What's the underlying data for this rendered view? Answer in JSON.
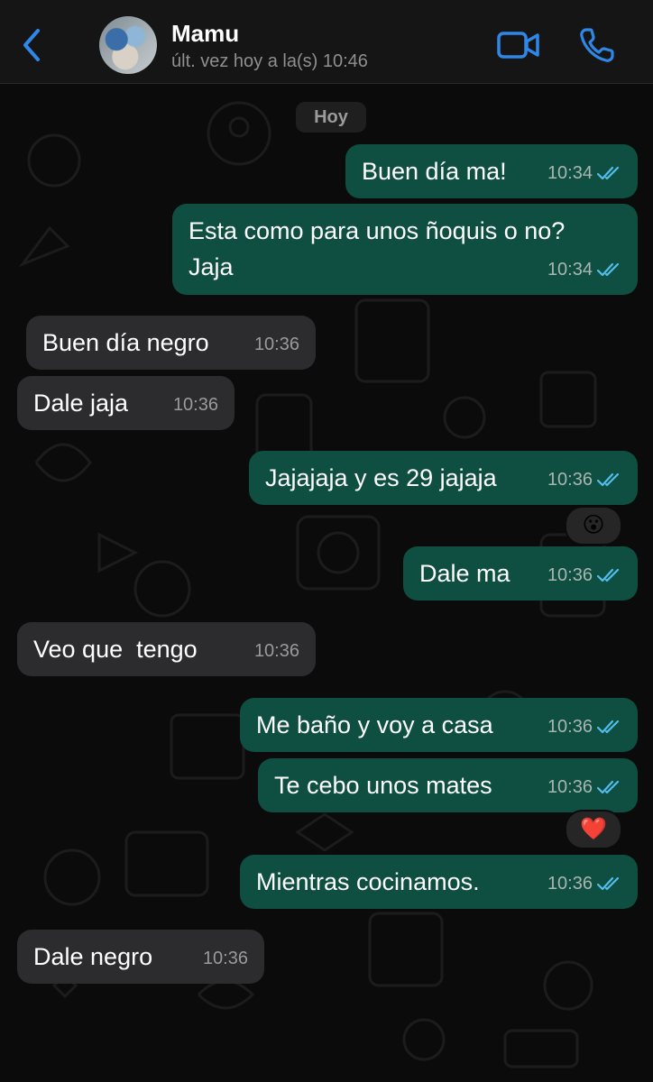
{
  "header": {
    "contact_name": "Mamu",
    "last_seen": "últ. vez hoy a la(s) 10:46",
    "back_icon": "chevron-left-icon",
    "video_icon": "video-camera-icon",
    "call_icon": "phone-icon",
    "accent_color": "#2f87e8"
  },
  "chat": {
    "date_label": "Hoy",
    "messages": [
      {
        "direction": "outgoing",
        "text": "Buen día ma!",
        "time": "10:34",
        "status": "read"
      },
      {
        "direction": "outgoing",
        "text": "Esta como para unos ñoquis o no?\nJaja",
        "time": "10:34",
        "status": "read"
      },
      {
        "direction": "incoming",
        "text": "Buen día negro",
        "time": "10:36"
      },
      {
        "direction": "incoming",
        "text": "Dale jaja",
        "time": "10:36"
      },
      {
        "direction": "outgoing",
        "text": "Jajajaja y es 29 jajaja",
        "time": "10:36",
        "status": "read",
        "reaction": "😮"
      },
      {
        "direction": "outgoing",
        "text": "Dale ma",
        "time": "10:36",
        "status": "read"
      },
      {
        "direction": "incoming",
        "text": "Veo que  tengo",
        "time": "10:36"
      },
      {
        "direction": "outgoing",
        "text": "Me baño y voy a casa",
        "time": "10:36",
        "status": "read"
      },
      {
        "direction": "outgoing",
        "text": "Te cebo unos mates",
        "time": "10:36",
        "status": "read",
        "reaction": "❤️"
      },
      {
        "direction": "outgoing",
        "text": "Mientras cocinamos.",
        "time": "10:36",
        "status": "read"
      },
      {
        "direction": "incoming",
        "text": "Dale negro",
        "time": "10:36"
      }
    ]
  },
  "colors": {
    "outgoing_bubble": "#0e4f42",
    "incoming_bubble": "#2c2c2e",
    "read_ticks": "#53bdeb"
  }
}
